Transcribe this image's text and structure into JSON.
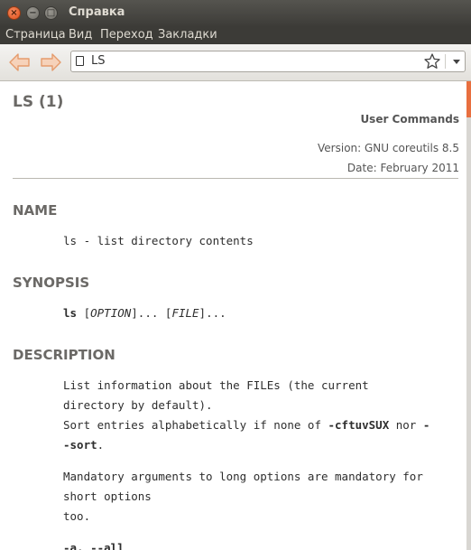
{
  "window": {
    "title": "Справка",
    "close_glyph": "×",
    "min_glyph": "−",
    "max_glyph": "□"
  },
  "menubar": [
    "Страница",
    "Вид",
    "Переход",
    "Закладки"
  ],
  "toolbar": {
    "back_icon": "back-arrow-icon",
    "forward_icon": "forward-arrow-icon",
    "location": "LS"
  },
  "page": {
    "title": "LS (1)",
    "user_commands": "User Commands",
    "version": "Version: GNU coreutils 8.5",
    "date": "Date: February 2011",
    "name_heading": "NAME",
    "name_text": "ls - list directory contents",
    "synopsis_heading": "SYNOPSIS",
    "synopsis_cmd": "ls",
    "synopsis_s1": " [",
    "synopsis_option": "OPTION",
    "synopsis_s2": "]... [",
    "synopsis_file": "FILE",
    "synopsis_s3": "]...",
    "description_heading": "DESCRIPTION",
    "desc_line1": "List information about the FILEs (the current",
    "desc_line2": "directory by default).",
    "desc_line3_pre": "Sort entries alphabetically if none of ",
    "desc_line3_bold": "-cftuvSUX",
    "desc_line3_post": " nor ",
    "desc_line3_dash": "-",
    "desc_line4_bold": "-sort",
    "desc_line4_post": ".",
    "desc_para2_line1": "Mandatory arguments to long options are mandatory for",
    "desc_para2_line2": "short options",
    "desc_para2_line3": "too.",
    "partial_line": "-a, --all"
  },
  "colors": {
    "accent": "#e86f3f",
    "heading": "#6b6966",
    "menubar_bg": "#3c3b37"
  }
}
